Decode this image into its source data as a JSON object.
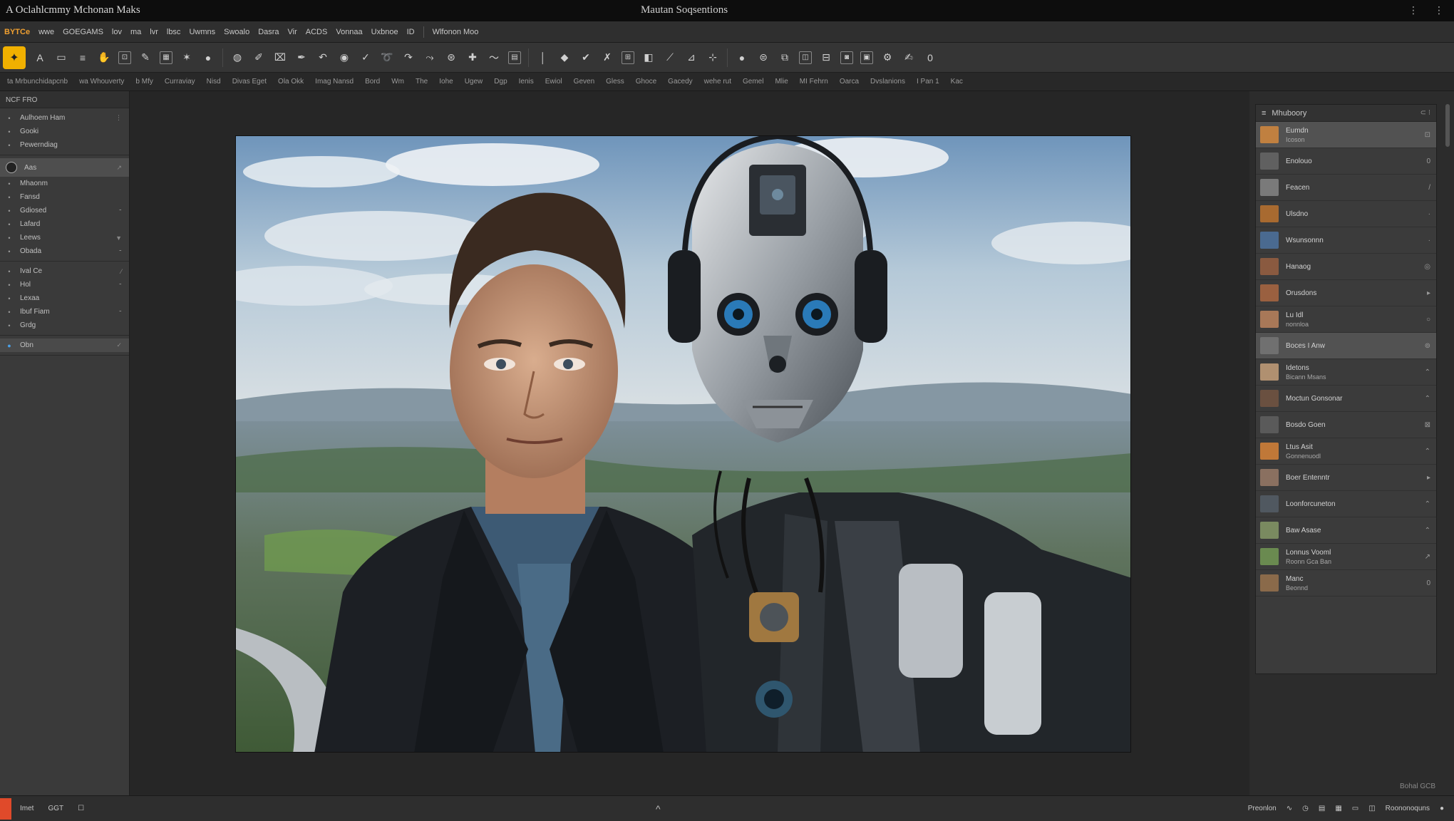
{
  "window": {
    "app_title": "A Oclahlcmmy Mchonan Maks",
    "document_title": "Mautan Soqsentions",
    "controls": [
      "⋮",
      "⋮"
    ]
  },
  "menubar": {
    "items": [
      "BYTCe",
      "wwe",
      "GOEGAMS",
      "lov",
      "ma",
      "lvr",
      "lbsc",
      "Uwmns",
      "Swoalo",
      "Dasra",
      "Vir",
      "ACDS",
      "Vonnaa",
      "Uxbnoe",
      "ID"
    ],
    "extra": "Wlfonon Moo"
  },
  "toolbar": {
    "active_tool": "selection-tool",
    "tool_icons": [
      "text-tool",
      "marquee-tool",
      "move-tool",
      "hand-tool",
      "crop-tool",
      "eyedropper-tool",
      "brush-tool",
      "eraser-tool",
      "pen-tool",
      "lasso-tool",
      "clone-tool",
      "heal-tool",
      "gradient-tool",
      "dodge-tool",
      "shape-tool",
      "zoom-tool"
    ],
    "badge_text": "0"
  },
  "optionsbar": {
    "items": [
      "ta Mrbunchidapcnb",
      "wa Whouverty",
      "b Mfy",
      "Curraviay",
      "Nisd",
      "Divas Eget",
      "Ola Okk",
      "Imag Nansd",
      "Bord",
      "Wm",
      "The",
      "Iohe",
      "Ugew",
      "Dgp",
      "Ienis",
      "Ewiol",
      "Geven",
      "Gless",
      "Ghoce",
      "Gacedy",
      "wehe rut",
      "Gemel",
      "Mlie",
      "MI Fehrn",
      "Oarca",
      "Dvslanions",
      "I Pan 1",
      "Kac"
    ]
  },
  "left_panel": {
    "header": "NCF FRO",
    "groups": [
      {
        "rows": [
          {
            "label": "Aulhoem Ham",
            "icon": "dot",
            "indicator": "⋮"
          },
          {
            "label": "Gooki",
            "icon": "dot",
            "indicator": ""
          },
          {
            "label": "Pewerndiag",
            "icon": "dot",
            "indicator": ""
          }
        ]
      },
      {
        "rows": [
          {
            "label": "Aas",
            "icon": "circle",
            "indicator": "↗",
            "selected": true
          },
          {
            "label": "Mhaonm",
            "icon": "dot",
            "indicator": ""
          },
          {
            "label": "Fansd",
            "icon": "dot",
            "indicator": ""
          },
          {
            "label": "Gdiosed",
            "icon": "dot",
            "indicator": "⁃"
          },
          {
            "label": "Lafard",
            "icon": "dot",
            "indicator": ""
          },
          {
            "label": "Leews",
            "icon": "dot",
            "indicator": "▼"
          },
          {
            "label": "Obada",
            "icon": "dot",
            "indicator": "⁃"
          }
        ]
      },
      {
        "rows": [
          {
            "label": "Ival Ce",
            "icon": "dot",
            "indicator": "⁄"
          },
          {
            "label": "Hol",
            "icon": "dot",
            "indicator": "⁃"
          },
          {
            "label": "Lexaa",
            "icon": "dot",
            "indicator": ""
          },
          {
            "label": "Ibuf Fiam",
            "icon": "dot",
            "indicator": "⁃"
          },
          {
            "label": "Grdg",
            "icon": "dot",
            "indicator": ""
          }
        ]
      },
      {
        "rows": [
          {
            "label": "Obn",
            "icon": "dot",
            "indicator": "✓",
            "highlight": true
          }
        ]
      }
    ]
  },
  "layers_panel": {
    "title": "Mhuboory",
    "header_icons": "⊂ ⁝",
    "layers": [
      {
        "name": "Eumdn",
        "sub": "Icoson",
        "thumb": "#c08040",
        "icon": "⊡",
        "selected": true
      },
      {
        "name": "Enolouo",
        "sub": "",
        "thumb": "#606060",
        "icon": "0"
      },
      {
        "name": "Feacen",
        "sub": "",
        "thumb": "#7a7a7a",
        "icon": "/"
      },
      {
        "name": "Ulsdno",
        "sub": "",
        "thumb": "#a86a30",
        "icon": "·"
      },
      {
        "name": "Wsunsonnn",
        "sub": "",
        "thumb": "#4a6a90",
        "icon": "·"
      },
      {
        "name": "Hanaog",
        "sub": "",
        "thumb": "#8a5a40",
        "icon": "◎"
      },
      {
        "name": "Orusdons",
        "sub": "",
        "thumb": "#9a6040",
        "icon": "▸"
      },
      {
        "name": "Lu Idl",
        "sub": "nonnloa",
        "thumb": "#a87858",
        "icon": "○"
      },
      {
        "name": "Boces I Anw",
        "sub": "",
        "thumb": "#707070",
        "icon": "⊚",
        "selected": true
      },
      {
        "name": "Idetons",
        "sub": "Bicann Msans",
        "thumb": "#b09070",
        "icon": "⌃"
      },
      {
        "name": "Moctun Gonsonar",
        "sub": "",
        "thumb": "#6a5040",
        "icon": "⌃"
      },
      {
        "name": "Bosdo Goen",
        "sub": "",
        "thumb": "#5a5a5a",
        "icon": "⊠"
      },
      {
        "name": "Ltus Asit",
        "sub": "Gonnenuodl",
        "thumb": "#c07838",
        "icon": "⌃"
      },
      {
        "name": "Boer Entenntr",
        "sub": "",
        "thumb": "#8a7060",
        "icon": "▸"
      },
      {
        "name": "Loonforcuneton",
        "sub": "",
        "thumb": "#505860",
        "icon": "⌃"
      },
      {
        "name": "Baw Asase",
        "sub": "",
        "thumb": "#7a8a60",
        "icon": "⌃"
      },
      {
        "name": "Lonnus Vooml",
        "sub": "Roonn Gca Ban",
        "thumb": "#6a8a50",
        "icon": "↗"
      },
      {
        "name": "Manc",
        "sub": "Beonnd",
        "thumb": "#8a6a4a",
        "icon": "0"
      }
    ],
    "footer_text": "Bohal GCB"
  },
  "statusbar": {
    "left": [
      "Imet",
      "GGT"
    ],
    "center": "^",
    "right": [
      "Preonlon",
      "Roononoquns"
    ]
  }
}
